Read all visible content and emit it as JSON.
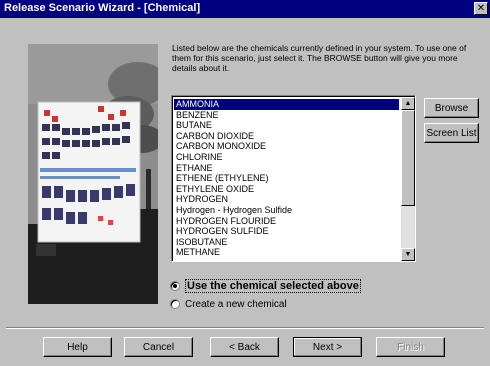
{
  "window": {
    "title": "Release Scenario Wizard - [Chemical]",
    "close_glyph": "✕"
  },
  "description": "Listed below are the chemicals currently defined in your system. To use one of them for this scenario, just select it.  The BROWSE button will give you more details about it.",
  "chemicals": {
    "items": [
      "AMMONIA",
      "BENZENE",
      "BUTANE",
      "CARBON DIOXIDE",
      "CARBON MONOXIDE",
      "CHLORINE",
      "ETHANE",
      "ETHENE (ETHYLENE)",
      "ETHYLENE OXIDE",
      "HYDROGEN",
      "Hydrogen - Hydrogen Sulfide",
      "HYDROGEN FLOURIDE",
      "HYDROGEN SULFIDE",
      "ISOBUTANE",
      "METHANE"
    ],
    "selected_index": 0
  },
  "side_buttons": {
    "browse": "Browse",
    "screen_list": "Screen List"
  },
  "options": {
    "use_selected": "Use the chemical selected above",
    "create_new": "Create a new chemical",
    "selected": "use_selected"
  },
  "footer": {
    "help": "Help",
    "cancel": "Cancel",
    "back": "< Back",
    "next": "Next >",
    "finish": "Finish"
  },
  "icons": {
    "scroll_up": "▲",
    "scroll_down": "▼"
  }
}
